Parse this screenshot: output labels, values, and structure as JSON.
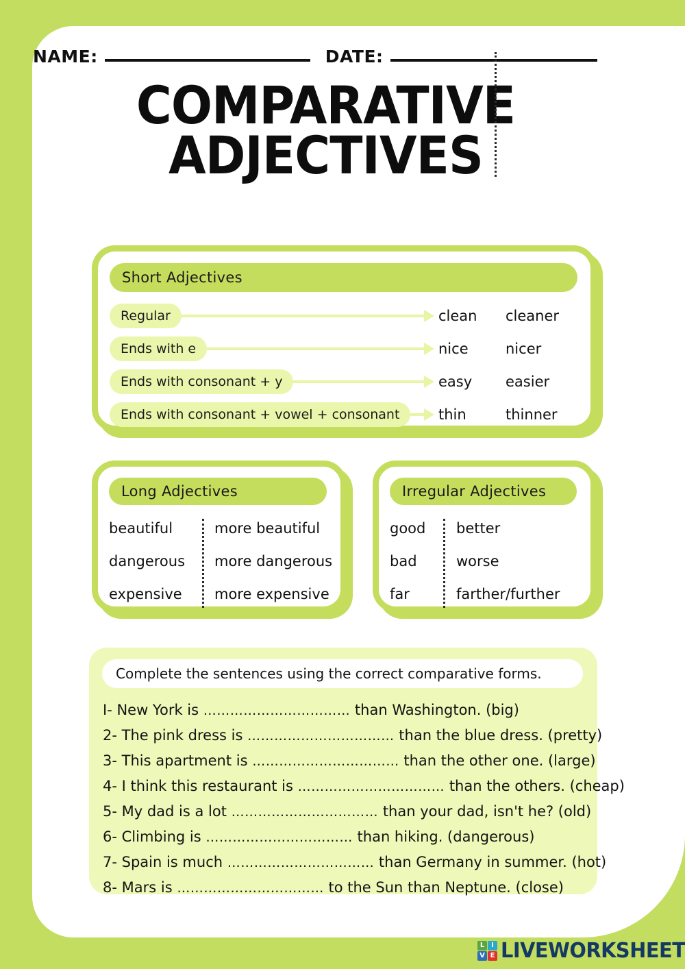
{
  "theme": {
    "page_background": "#c3dd60",
    "card_background": "#ffffff",
    "box_border": "#c4dd5c",
    "header_pill": "#c4dd5c",
    "rule_pill": "#eaf6ab",
    "arrow": "#e7f5a4",
    "exercise_background": "#eef8b9",
    "text": "#131313",
    "logo_text": "#143a63"
  },
  "header": {
    "name_label": "NAME:",
    "date_label": "DATE:"
  },
  "title": {
    "line1": "COMPARATIVE",
    "line2": "ADJECTIVES"
  },
  "short_adjectives": {
    "heading": "Short Adjectives",
    "rows": [
      {
        "rule": "Regular",
        "base": "clean",
        "comparative": "cleaner"
      },
      {
        "rule": "Ends with e",
        "base": "nice",
        "comparative": "nicer"
      },
      {
        "rule": "Ends with consonant + y",
        "base": "easy",
        "comparative": "easier"
      },
      {
        "rule": "Ends with consonant + vowel + consonant",
        "base": "thin",
        "comparative": "thinner"
      }
    ]
  },
  "long_adjectives": {
    "heading": "Long Adjectives",
    "rows": [
      {
        "base": "beautiful",
        "comparative": "more beautiful"
      },
      {
        "base": "dangerous",
        "comparative": "more dangerous"
      },
      {
        "base": "expensive",
        "comparative": "more expensive"
      }
    ]
  },
  "irregular_adjectives": {
    "heading": "Irregular Adjectives",
    "rows": [
      {
        "base": "good",
        "comparative": "better"
      },
      {
        "base": "bad",
        "comparative": "worse"
      },
      {
        "base": "far",
        "comparative": "farther/further"
      }
    ]
  },
  "exercise": {
    "instruction": "Complete the sentences using the correct comparative forms.",
    "blank": "……………………………",
    "items": [
      {
        "number": "I-",
        "before": " New York is ",
        "after": " than Washington. (big)"
      },
      {
        "number": "2-",
        "before": " The pink dress is ",
        "after": " than the blue dress. (pretty)"
      },
      {
        "number": "3-",
        "before": " This apartment is ",
        "after": " than the other one. (large)"
      },
      {
        "number": "4-",
        "before": " I think this restaurant is ",
        "after": " than the others. (cheap)"
      },
      {
        "number": "5-",
        "before": " My dad is a lot ",
        "after": " than your dad, isn't he? (old)"
      },
      {
        "number": "6-",
        "before": " Climbing is ",
        "after": " than hiking. (dangerous)"
      },
      {
        "number": "7-",
        "before": " Spain is much ",
        "after": " than Germany in summer. (hot)"
      },
      {
        "number": "8-",
        "before": " Mars is ",
        "after": " to the Sun than Neptune. (close)"
      }
    ]
  },
  "footer": {
    "brand": "LIVEWORKSHEETS",
    "logo_blocks": [
      {
        "letter": "L",
        "color": "#5aa544"
      },
      {
        "letter": "I",
        "color": "#2aa9c9"
      },
      {
        "letter": "V",
        "color": "#2f6fb5"
      },
      {
        "letter": "E",
        "color": "#e0342b"
      }
    ]
  }
}
